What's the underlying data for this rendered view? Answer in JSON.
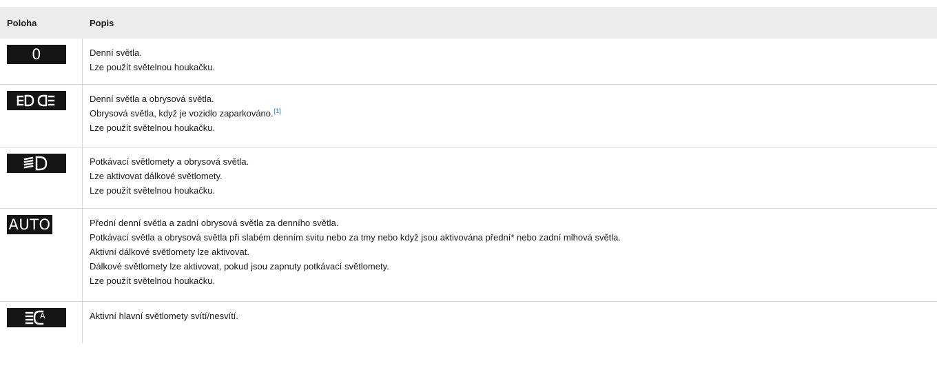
{
  "header": {
    "col_position": "Poloha",
    "col_description": "Popis"
  },
  "rows": [
    {
      "icon": "zero-position-icon",
      "icon_text": "0",
      "lines": [
        "Denní světla.",
        "Lze použít světelnou houkačku."
      ]
    },
    {
      "icon": "position-lights-icon",
      "lines": [
        "Denní světla a obrysová světla.",
        "Obrysová světla, když je vozidlo zaparkováno.",
        "Lze použít světelnou houkačku."
      ],
      "footnote": "[1]"
    },
    {
      "icon": "low-beam-icon",
      "lines": [
        "Potkávací světlomety a obrysová světla.",
        "Lze aktivovat dálkové světlomety.",
        "Lze použít světelnou houkačku."
      ]
    },
    {
      "icon": "auto-lights-icon",
      "icon_text": "AUTO",
      "lines": [
        "Přední denní světla a zadní obrysová světla za denního světla.",
        "Potkávací světla a obrysová světla při slabém denním svitu nebo za tmy nebo když jsou aktivována přední* nebo zadní mlhová světla.",
        "Aktivní dálkové světlomety lze aktivovat.",
        "Dálkové světlomety lze aktivovat, pokud jsou zapnuty potkávací světlomety.",
        "Lze použít světelnou houkačku."
      ]
    },
    {
      "icon": "active-high-beam-icon",
      "lines": [
        "Aktivní hlavní světlomety svítí/nesvítí."
      ]
    }
  ]
}
